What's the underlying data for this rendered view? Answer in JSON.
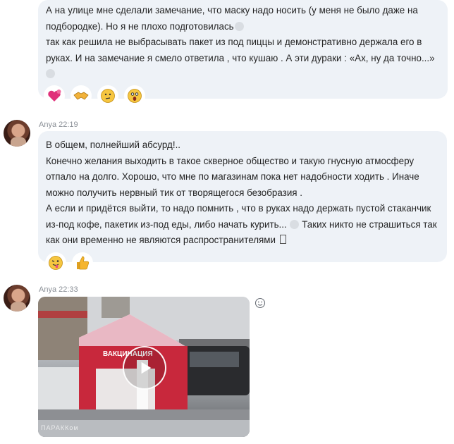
{
  "messages": [
    {
      "lines": [
        "А на улице мне сделали замечание, что маску надо носить (у меня не было даже на",
        "подбородке). Но я не плохо подготовилась",
        "так как решила не выбрасывать пакет из под пиццы и демонстративно держала его в",
        "руках. И на замечание я смело ответила , что кушаю . А эти дураки : «Ах, ну да точно...»"
      ],
      "reactions": [
        "heart-eyes",
        "handshake",
        "thinking-face",
        "shocked-face"
      ]
    },
    {
      "author": "Anya",
      "time": "22:19",
      "lines": [
        "В общем, полнейший абсурд!..",
        "Конечно желания выходить в такое скверное общество и такую гнусную атмосферу",
        "отпало на долго. Хорошо, что мне по магазинам пока нет надобности ходить . Иначе",
        "можно получить нервный тик от творящегося безобразия .",
        "А если и придётся выйти, то надо помнить , что в руках надо держать пустой стаканчик",
        "из-под кофе, пакетик из-под еды, либо начать курить...",
        "Таких никто не страшиться так",
        "как они временно не являются распространителями"
      ],
      "reactions": [
        "tongue-face",
        "thumbs-up"
      ]
    },
    {
      "author": "Anya",
      "time": "22:33",
      "video": {
        "sign_text": "ВАКЦИНАЦИЯ",
        "watermark": "ПАРАККом"
      }
    }
  ],
  "icons": {
    "add_reaction": "smiley-outline-icon",
    "play": "play-icon"
  },
  "colors": {
    "bubble": "#eef2f7",
    "meta_text": "#8a8f96",
    "thumbs_up": "#f5b52e"
  }
}
